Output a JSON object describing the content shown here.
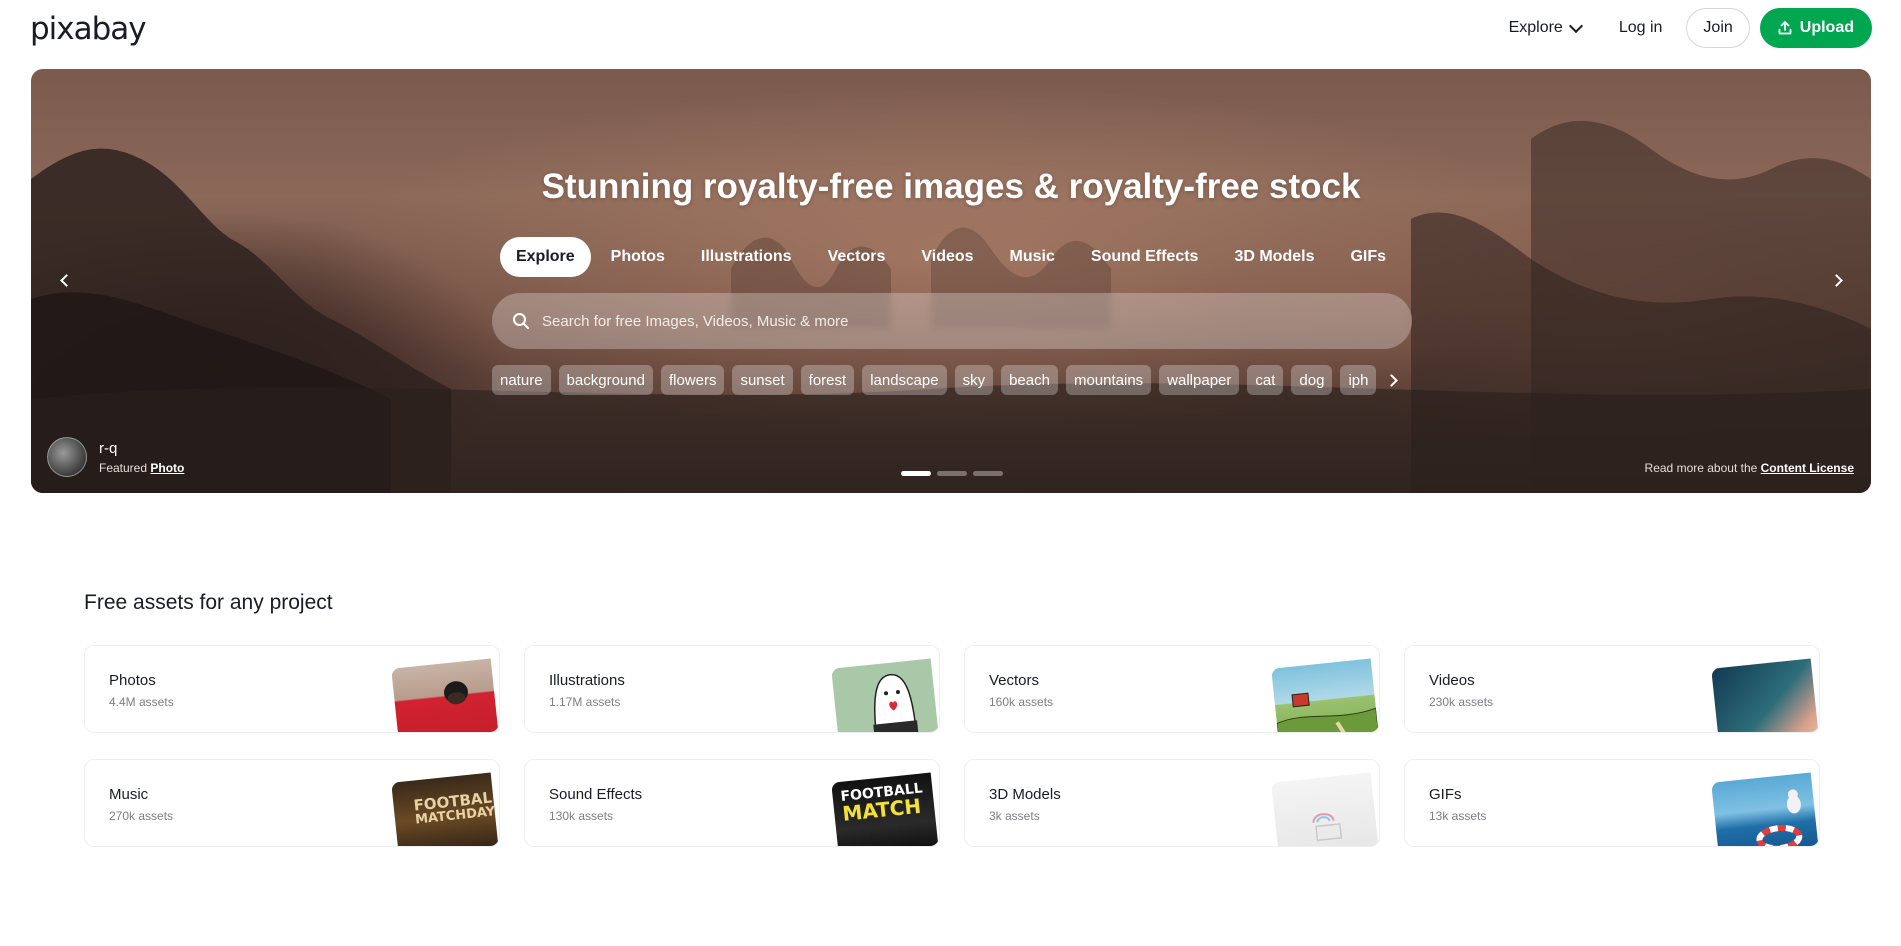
{
  "header": {
    "logo": "pixabay",
    "explore_label": "Explore",
    "login_label": "Log in",
    "join_label": "Join",
    "upload_label": "Upload"
  },
  "hero": {
    "title": "Stunning royalty-free images & royalty-free stock",
    "tabs": [
      "Explore",
      "Photos",
      "Illustrations",
      "Vectors",
      "Videos",
      "Music",
      "Sound Effects",
      "3D Models",
      "GIFs"
    ],
    "active_tab": "Explore",
    "search_placeholder": "Search for free Images, Videos, Music & more",
    "tags": [
      "nature",
      "background",
      "flowers",
      "sunset",
      "forest",
      "landscape",
      "sky",
      "beach",
      "mountains",
      "wallpaper",
      "cat",
      "dog",
      "iph"
    ],
    "credit": {
      "user": "r-q",
      "featured_prefix": "Featured",
      "featured_link": "Photo"
    },
    "license_prefix": "Read more about the",
    "license_link": "Content License",
    "slides_count": 3,
    "active_slide": 1
  },
  "assets": {
    "title": "Free assets for any project",
    "cards": [
      {
        "name": "Photos",
        "count": "4.4M assets",
        "thumb": "photos"
      },
      {
        "name": "Illustrations",
        "count": "1.17M assets",
        "thumb": "illus"
      },
      {
        "name": "Vectors",
        "count": "160k assets",
        "thumb": "vectors"
      },
      {
        "name": "Videos",
        "count": "230k assets",
        "thumb": "videos"
      },
      {
        "name": "Music",
        "count": "270k assets",
        "thumb": "music"
      },
      {
        "name": "Sound Effects",
        "count": "130k assets",
        "thumb": "sfx"
      },
      {
        "name": "3D Models",
        "count": "3k assets",
        "thumb": "3d"
      },
      {
        "name": "GIFs",
        "count": "13k assets",
        "thumb": "gifs"
      }
    ],
    "thumb_text": {
      "music": [
        "FOOTBALL",
        "MATCHDAY"
      ],
      "sfx": [
        "FOOTBALL",
        "MATCH"
      ]
    }
  },
  "colors": {
    "brand_green": "#00a650",
    "text": "#191b26"
  }
}
